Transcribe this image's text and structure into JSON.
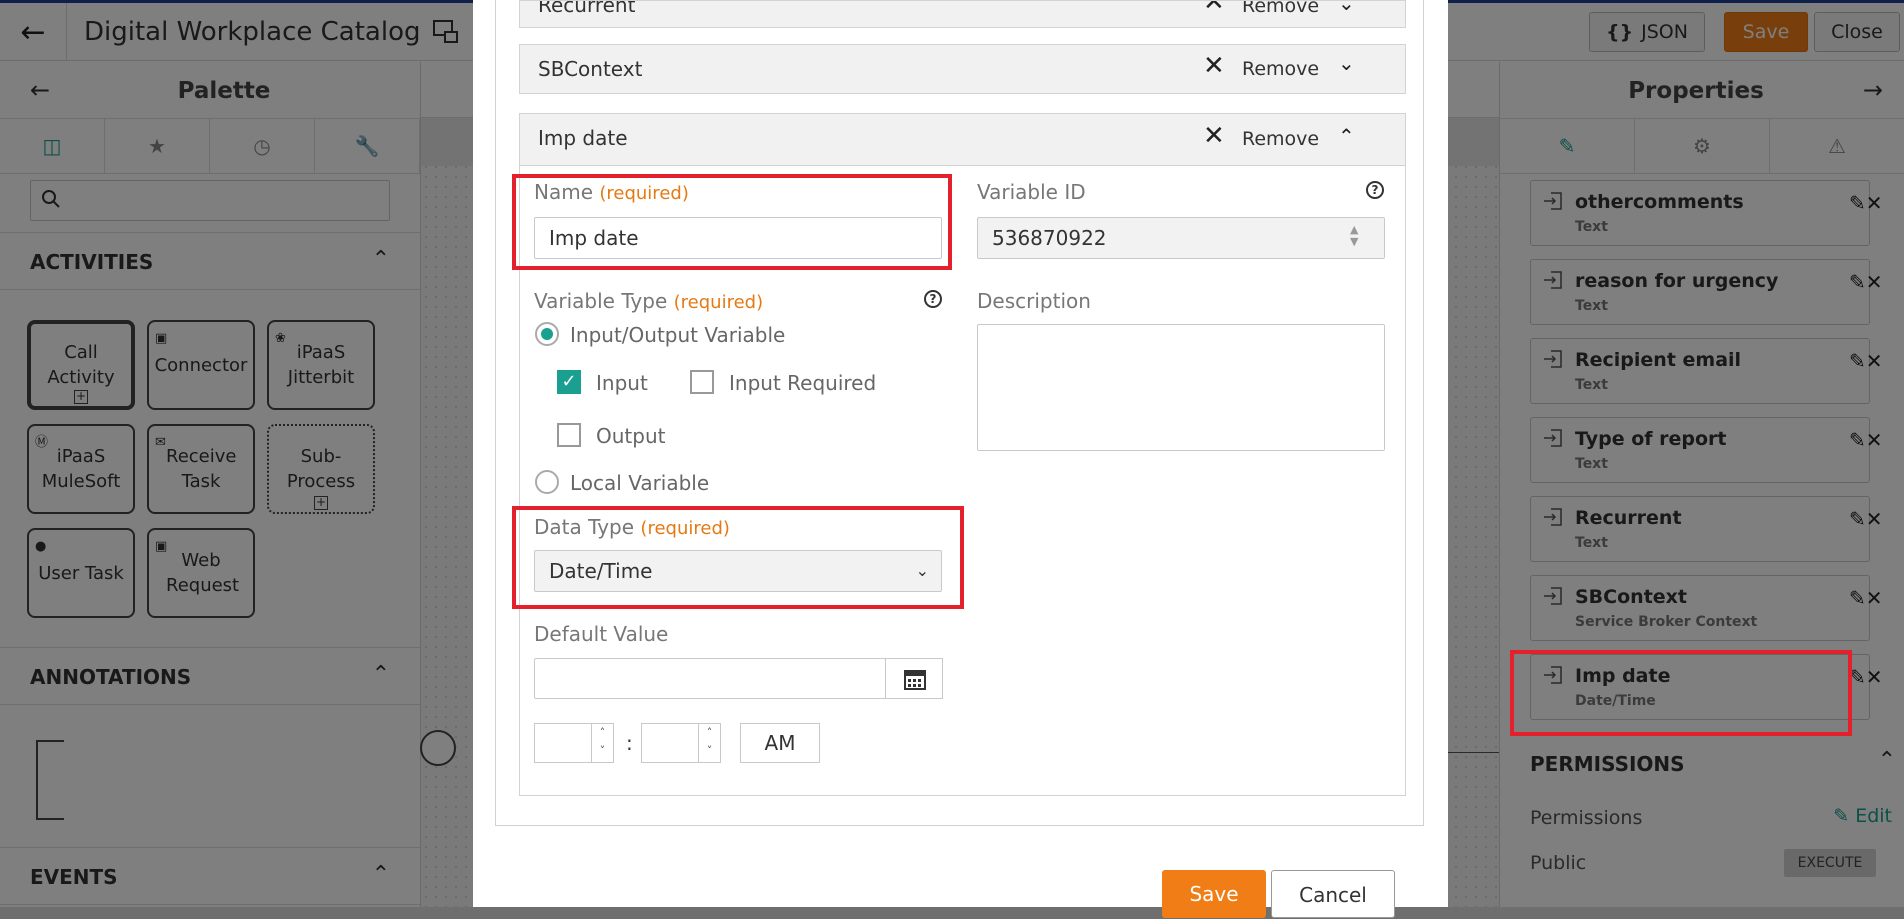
{
  "header": {
    "title": "Digital Workplace Catalog",
    "json_label": "JSON",
    "save_label": "Save",
    "close_label": "Close"
  },
  "palette": {
    "title": "Palette",
    "sections": {
      "activities": "ACTIVITIES",
      "annotations": "ANNOTATIONS",
      "events": "EVENTS"
    },
    "tiles": [
      {
        "label": "Call Activity"
      },
      {
        "label": "Connector"
      },
      {
        "label": "iPaaS Jitterbit"
      },
      {
        "label": "iPaaS MuleSoft"
      },
      {
        "label": "Receive Task"
      },
      {
        "label": "Sub-Process"
      },
      {
        "label": "User Task"
      },
      {
        "label": "Web Request"
      }
    ]
  },
  "properties": {
    "title": "Properties",
    "variables": [
      {
        "name": "othercomments",
        "type": "Text"
      },
      {
        "name": "reason for urgency",
        "type": "Text"
      },
      {
        "name": "Recipient email",
        "type": "Text"
      },
      {
        "name": "Type of report",
        "type": "Text"
      },
      {
        "name": "Recurrent",
        "type": "Text"
      },
      {
        "name": "SBContext",
        "type": "Service Broker Context"
      },
      {
        "name": "Imp date",
        "type": "Date/Time"
      }
    ],
    "permissions": {
      "heading": "PERMISSIONS",
      "permissions_label": "Permissions",
      "edit_label": "Edit",
      "public_label": "Public",
      "execute_badge": "EXECUTE"
    }
  },
  "modal": {
    "accordions": [
      {
        "title": "Recurrent",
        "remove_label": "Remove"
      },
      {
        "title": "SBContext",
        "remove_label": "Remove"
      },
      {
        "title": "Imp date",
        "remove_label": "Remove"
      }
    ],
    "form": {
      "name_label": "Name",
      "required_tag": "(required)",
      "name_value": "Imp date",
      "variable_id_label": "Variable ID",
      "variable_id_value": "536870922",
      "variable_type_label": "Variable Type",
      "description_label": "Description",
      "io_variable_label": "Input/Output Variable",
      "input_label": "Input",
      "input_required_label": "Input Required",
      "output_label": "Output",
      "local_variable_label": "Local Variable",
      "data_type_label": "Data Type",
      "data_type_value": "Date/Time",
      "default_value_label": "Default Value",
      "time_separator": ":",
      "ampm": "AM"
    },
    "save_label": "Save",
    "cancel_label": "Cancel"
  },
  "colors": {
    "accent": "#1aa090",
    "primary_button": "#f07d16",
    "highlight": "#e3202c"
  }
}
